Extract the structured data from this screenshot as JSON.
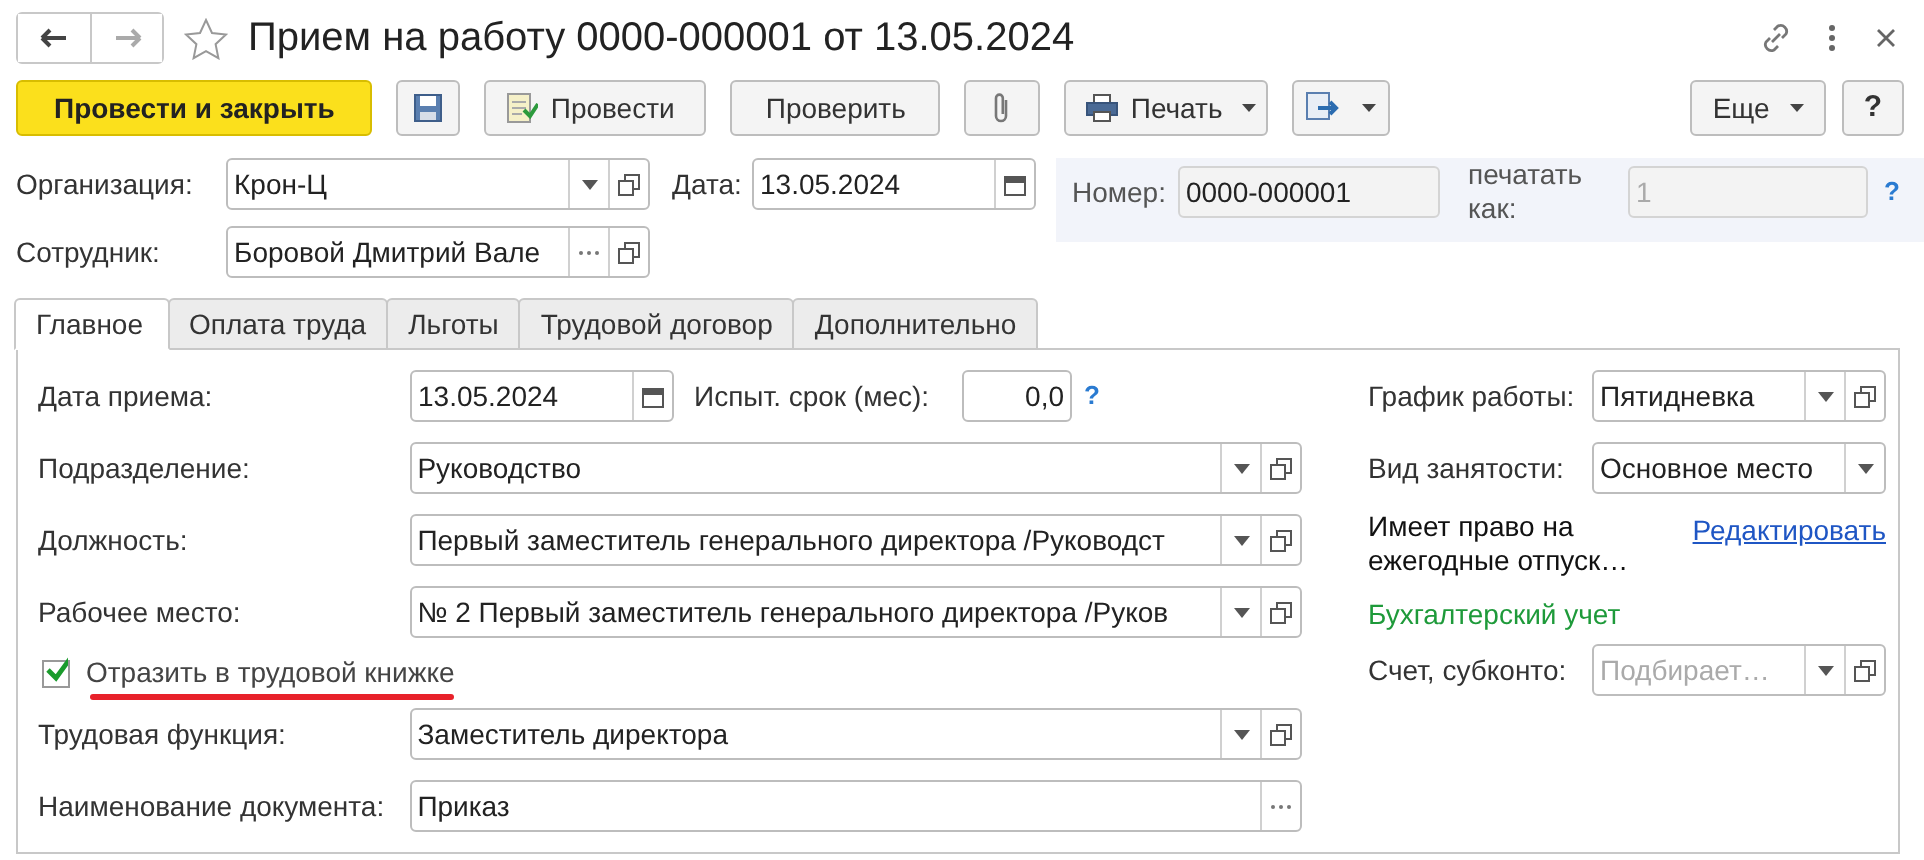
{
  "window": {
    "title": "Прием на работу 0000-000001 от 13.05.2024"
  },
  "toolbar": [
    {
      "kind": "primary",
      "label": "Провести и закрыть"
    },
    {
      "kind": "save"
    },
    {
      "kind": "post",
      "label": "Провести"
    },
    {
      "kind": "plain",
      "label": "Проверить"
    },
    {
      "kind": "attach"
    },
    {
      "kind": "print",
      "label": "Печать"
    },
    {
      "kind": "related"
    }
  ],
  "toolbar_right": [
    {
      "kind": "menu",
      "label": "Еще"
    },
    {
      "kind": "help",
      "label": "?"
    }
  ],
  "header": {
    "organization": {
      "label": "Организация:",
      "value": "Крон-Ц",
      "dropdown": true,
      "open": true
    },
    "date": {
      "label": "Дата:",
      "value": "13.05.2024",
      "calendar": true
    },
    "number": {
      "label": "Номер:",
      "value": "0000-000001"
    },
    "print_as": {
      "label": "печатать как:",
      "placeholder": "1",
      "disabled": true,
      "help": "?"
    },
    "employee": {
      "label": "Сотрудник:",
      "value": "Боровой Дмитрий Вале",
      "choose": true,
      "open": true
    }
  },
  "tabs": [
    {
      "label": "Главное",
      "selected": true
    },
    {
      "label": "Оплата труда",
      "selected": false
    },
    {
      "label": "Льготы",
      "selected": false
    },
    {
      "label": "Трудовой договор",
      "selected": false
    },
    {
      "label": "Дополнительно",
      "selected": false
    }
  ],
  "main": [
    {
      "kind": "date",
      "label": "Дата приема:",
      "value": "13.05.2024",
      "calendar": true,
      "extra": {
        "label": "Испыт. срок (мес):",
        "value": "0,0",
        "help": "?"
      }
    },
    {
      "kind": "field",
      "label": "Подразделение:",
      "value": "Руководство",
      "dropdown": true,
      "open": true
    },
    {
      "kind": "field",
      "label": "Должность:",
      "value": "Первый заместитель генерального директора /Руководст",
      "dropdown": true,
      "open": true
    },
    {
      "kind": "field",
      "label": "Рабочее место:",
      "value": "№ 2 Первый заместитель генерального директора /Руков",
      "dropdown": true,
      "open": true
    },
    {
      "kind": "checkbox",
      "label": "Отразить в трудовой книжке",
      "checked": true,
      "underlined": true
    },
    {
      "kind": "field",
      "label": "Трудовая функция:",
      "value": "Заместитель директора",
      "dropdown": true,
      "open": true
    },
    {
      "kind": "field",
      "label": "Наименование документа:",
      "value": "Приказ",
      "choose": true
    }
  ],
  "side": [
    {
      "kind": "field",
      "label": "График работы:",
      "value": "Пятидневка",
      "dropdown": true,
      "open": true
    },
    {
      "kind": "field",
      "label": "Вид занятости:",
      "value": "Основное место",
      "dropdown": true
    },
    {
      "kind": "note",
      "text": "Имеет право на ежегодные отпуск…",
      "link": "Редактировать"
    },
    {
      "kind": "heading",
      "text": "Бухгалтерский учет"
    },
    {
      "kind": "field",
      "label": "Счет, субконто:",
      "placeholder": "Подбирает…",
      "dropdown": true,
      "open": true
    }
  ]
}
